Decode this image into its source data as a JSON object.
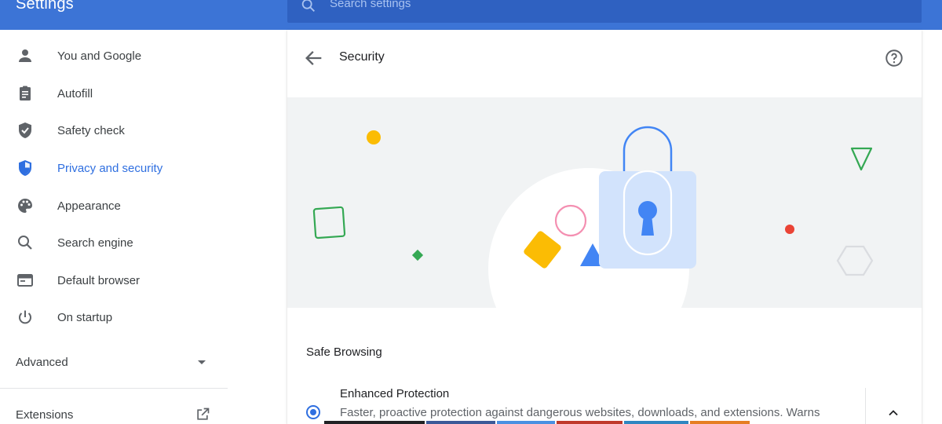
{
  "app": {
    "title": "Settings"
  },
  "search": {
    "placeholder": "Search settings"
  },
  "sidebar": {
    "items": [
      {
        "label": "You and Google",
        "icon": "person-icon",
        "active": false
      },
      {
        "label": "Autofill",
        "icon": "clipboard-icon",
        "active": false
      },
      {
        "label": "Safety check",
        "icon": "shield-check-icon",
        "active": false
      },
      {
        "label": "Privacy and security",
        "icon": "shield-icon",
        "active": true
      },
      {
        "label": "Appearance",
        "icon": "palette-icon",
        "active": false
      },
      {
        "label": "Search engine",
        "icon": "search-icon",
        "active": false
      },
      {
        "label": "Default browser",
        "icon": "browser-icon",
        "active": false
      },
      {
        "label": "On startup",
        "icon": "power-icon",
        "active": false
      }
    ],
    "advanced": {
      "label": "Advanced",
      "icon": "caret-down-icon"
    },
    "extensions": {
      "label": "Extensions",
      "icon": "open-in-new-icon"
    }
  },
  "main": {
    "title": "Security",
    "back_icon": "arrow-back-icon",
    "help_icon": "help-icon",
    "section": {
      "title": "Safe Browsing"
    },
    "option": {
      "title": "Enhanced Protection",
      "description": "Faster, proactive protection against dangerous websites, downloads, and extensions. Warns",
      "selected": true,
      "expand_icon": "chevron-up-icon"
    }
  },
  "colors": {
    "header": "#3c74d6",
    "accent": "#2f6fe0",
    "yellow": "#fbbc04",
    "green": "#34a853",
    "red": "#ea4335",
    "pink": "#f48fb1"
  }
}
